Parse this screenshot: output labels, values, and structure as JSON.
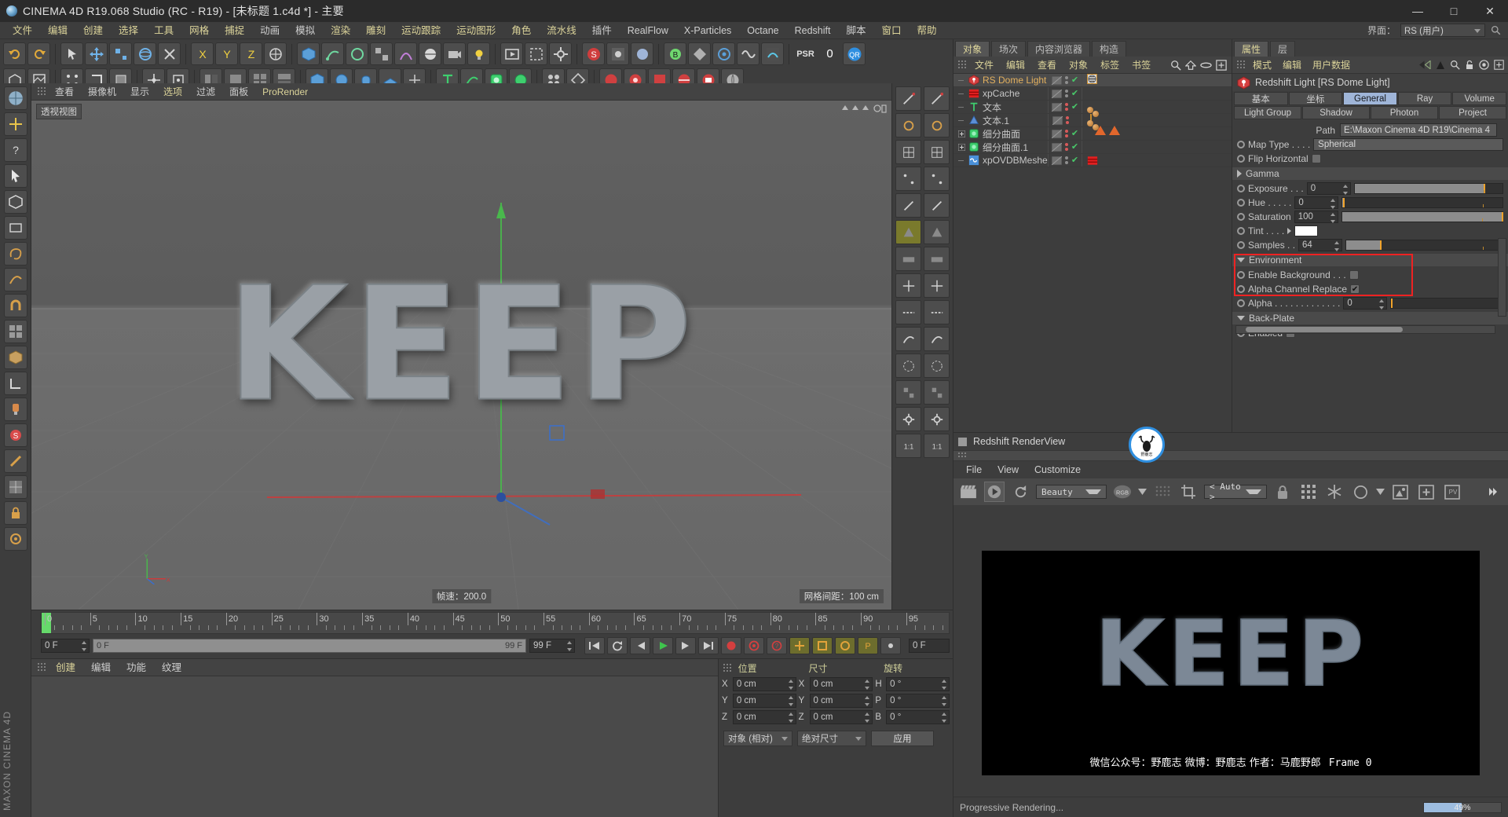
{
  "window": {
    "title": "CINEMA 4D R19.068 Studio (RC - R19) - [未标题 1.c4d *] - 主要",
    "minimize": "—",
    "maximize": "□",
    "close": "✕"
  },
  "menubar": {
    "items": [
      {
        "label": "文件",
        "hl": true
      },
      {
        "label": "编辑",
        "hl": true
      },
      {
        "label": "创建",
        "hl": true
      },
      {
        "label": "选择",
        "hl": true
      },
      {
        "label": "工具",
        "hl": true
      },
      {
        "label": "网格",
        "hl": true
      },
      {
        "label": "捕捉",
        "hl": true
      },
      {
        "label": "动画",
        "hl": false
      },
      {
        "label": "模拟",
        "hl": false
      },
      {
        "label": "渲染",
        "hl": true
      },
      {
        "label": "雕刻",
        "hl": true
      },
      {
        "label": "运动跟踪",
        "hl": true
      },
      {
        "label": "运动图形",
        "hl": true
      },
      {
        "label": "角色",
        "hl": true
      },
      {
        "label": "流水线",
        "hl": true
      },
      {
        "label": "插件",
        "hl": false
      },
      {
        "label": "RealFlow",
        "hl": false
      },
      {
        "label": "X-Particles",
        "hl": false
      },
      {
        "label": "Octane",
        "hl": false
      },
      {
        "label": "Redshift",
        "hl": false
      },
      {
        "label": "脚本",
        "hl": false
      },
      {
        "label": "窗口",
        "hl": true
      },
      {
        "label": "帮助",
        "hl": true
      }
    ],
    "interface_label": "界面：",
    "interface_value": "RS (用户)"
  },
  "viewport": {
    "menu": [
      "查看",
      "摄像机",
      "显示",
      "选项",
      "过滤",
      "面板",
      "ProRender"
    ],
    "menu_highlight": [
      "选项",
      "ProRender"
    ],
    "tag": "透视视图",
    "fps_label": "帧速：200.0",
    "grid_label": "网格间距：100 cm",
    "model_text": "KEEP",
    "axis": {
      "x": "X",
      "y": "Y",
      "z": "Z"
    }
  },
  "timeline": {
    "ticks": [
      0,
      5,
      10,
      15,
      20,
      25,
      30,
      35,
      40,
      45,
      50,
      55,
      60,
      65,
      70,
      75,
      80,
      85,
      90,
      95
    ],
    "current_frame": "0 F",
    "range_start": "0 F",
    "range_end": "99 F",
    "end_field": "99 F",
    "right_field": "0 F"
  },
  "material_manager": {
    "menu": [
      "创建",
      "编辑",
      "功能",
      "纹理"
    ],
    "menu_highlight": [
      "创建"
    ]
  },
  "coordinates": {
    "headers": [
      "位置",
      "尺寸",
      "旋转"
    ],
    "rows": [
      {
        "axis": "X",
        "pos": "0 cm",
        "size": "0 cm",
        "rot_label": "H",
        "rot": "0 °"
      },
      {
        "axis": "Y",
        "pos": "0 cm",
        "size": "0 cm",
        "rot_label": "P",
        "rot": "0 °"
      },
      {
        "axis": "Z",
        "pos": "0 cm",
        "size": "0 cm",
        "rot_label": "B",
        "rot": "0 °"
      }
    ],
    "mode_select": "对象 (相对)",
    "size_select": "绝对尺寸",
    "apply_button": "应用"
  },
  "object_manager": {
    "tabs": [
      {
        "label": "对象",
        "active": true
      },
      {
        "label": "场次",
        "active": false
      },
      {
        "label": "内容浏览器",
        "active": false
      },
      {
        "label": "构造",
        "active": false
      }
    ],
    "menu": [
      "文件",
      "编辑",
      "查看",
      "对象",
      "标签",
      "书签"
    ],
    "menu_highlight": [
      "文件",
      "编辑",
      "查看",
      "对象",
      "标签",
      "书签"
    ],
    "tools": [
      "search-icon",
      "home-icon",
      "ellipse-icon",
      "add-icon"
    ],
    "items": [
      {
        "name": "RS Dome Light",
        "icon": "light-icon",
        "selected": true,
        "dots": [
          "grey",
          "grey"
        ],
        "check": true,
        "tags": [
          "dome-tag"
        ]
      },
      {
        "name": "xpCache",
        "icon": "cache-icon",
        "selected": false,
        "dots": [
          "grey",
          "grey"
        ],
        "check": true,
        "tags": []
      },
      {
        "name": "文本",
        "icon": "text-icon",
        "selected": false,
        "dots": [
          "red",
          "red"
        ],
        "check": true,
        "tags": [
          "sphere-pair"
        ]
      },
      {
        "name": "文本.1",
        "icon": "cone-icon",
        "selected": false,
        "dots": [
          "red",
          "red"
        ],
        "check": false,
        "tags": [
          "sphere-pair",
          "checker",
          "triangle",
          "triangle"
        ]
      },
      {
        "name": "细分曲面",
        "icon": "subdiv-icon",
        "selected": false,
        "dots": [
          "red",
          "red"
        ],
        "check": true,
        "tags": [],
        "expandable": true
      },
      {
        "name": "细分曲面.1",
        "icon": "subdiv-icon",
        "selected": false,
        "dots": [
          "red",
          "red"
        ],
        "check": true,
        "tags": [],
        "expandable": true
      },
      {
        "name": "xpOVDBMesher",
        "icon": "mesher-icon",
        "selected": false,
        "dots": [
          "grey",
          "grey"
        ],
        "check": true,
        "tags": [
          "cache-tag"
        ]
      }
    ]
  },
  "attributes": {
    "tabs": [
      {
        "label": "属性",
        "active": true
      },
      {
        "label": "层",
        "active": false
      }
    ],
    "menu": [
      "模式",
      "编辑",
      "用户数据"
    ],
    "menu_highlight": [
      "模式",
      "编辑",
      "用户数据"
    ],
    "object_title": "Redshift Light [RS Dome Light]",
    "param_tabs": [
      {
        "label": "基本",
        "active": false
      },
      {
        "label": "坐标",
        "active": false
      },
      {
        "label": "General",
        "active": true
      },
      {
        "label": "Ray",
        "active": false
      },
      {
        "label": "Volume",
        "active": false
      },
      {
        "label": "Light Group",
        "active": false
      },
      {
        "label": "Shadow",
        "active": false
      },
      {
        "label": "Photon",
        "active": false
      },
      {
        "label": "Project",
        "active": false
      }
    ],
    "path_label": "Path",
    "path_value": "E:\\Maxon Cinema 4D R19\\Cinema 4",
    "params": [
      {
        "label": "Map Type",
        "dots": " . . . .",
        "type": "select",
        "value": "Spherical"
      },
      {
        "label": "Flip Horizontal",
        "dots": "",
        "type": "checkbox",
        "checked": false
      },
      {
        "label": "Gamma",
        "type": "group",
        "collapsed": true
      },
      {
        "label": "Exposure",
        "dots": " . . .",
        "type": "number",
        "value": "0",
        "slider_pct": 88
      },
      {
        "label": "Hue",
        "dots": " . . . . .",
        "type": "number",
        "value": "0",
        "slider_pct": 1
      },
      {
        "label": "Saturation",
        "dots": "",
        "type": "number",
        "value": "100",
        "slider_pct": 100
      },
      {
        "label": "Tint",
        "dots": " . . . .",
        "type": "color",
        "value": "#ffffff"
      },
      {
        "label": "Samples",
        "dots": " . .",
        "type": "number",
        "value": "64",
        "slider_pct": 22
      }
    ],
    "environment": {
      "title": "Environment",
      "enable_background_label": "Enable Background . . .",
      "enable_background_checked": false,
      "alpha_channel_replace_label": "Alpha Channel Replace",
      "alpha_channel_replace_checked": true,
      "alpha_label": "Alpha . . . . . . . . . . . . .",
      "alpha_value": "0"
    },
    "backplate": {
      "title": "Back-Plate",
      "enabled_label": "Enabled",
      "enabled_checked": false
    }
  },
  "render_view": {
    "title": "Redshift RenderView",
    "menu": [
      "File",
      "View",
      "Customize"
    ],
    "toolbar": {
      "render_icon": "clapper-icon",
      "play_icon": "play-icon",
      "refresh_icon": "refresh-icon",
      "aov_select": "Beauty",
      "channel_select": "RGB",
      "region_icon": "dots-icon",
      "crop_icon": "crop-icon",
      "zoom_select": "< Auto >",
      "lock_icon": "lock-icon",
      "grid_icon": "grid-icon",
      "snow_icon": "snowflake-icon",
      "circle_icon": "circle-icon",
      "image_icon": "image-icon",
      "plus_icon": "add-image-icon",
      "pv_icon": "pv-icon",
      "overflow_icon": "chevron-right-icon"
    },
    "canvas_text": "KEEP",
    "credit": "微信公众号：野鹿志   微博：野鹿志   作者：马鹿野郎",
    "frame_label": "Frame  0",
    "status": "Progressive Rendering...",
    "progress_text": "49%",
    "progress_pct": 49,
    "badge": "野鹿志"
  },
  "brand": "MAXON CINEMA 4D",
  "colors": {
    "accent_yellow": "#dcd49a",
    "selected_blue": "#9fb5d8",
    "highlight_red": "#ee2222",
    "check_green": "#49c86a",
    "orange_tag": "#e2672c",
    "panel_bg": "#3d3d3d"
  }
}
